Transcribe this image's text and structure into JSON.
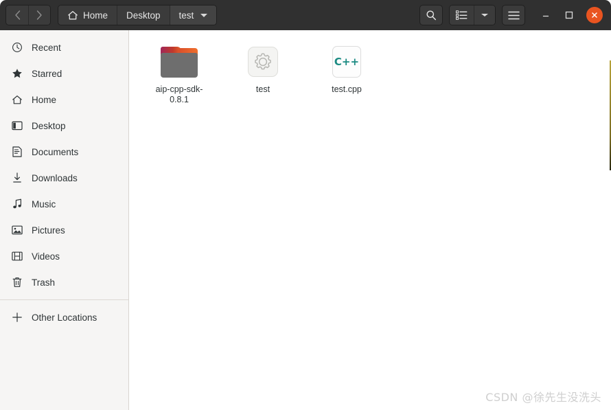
{
  "window": {
    "title": "test",
    "accent_color": "#e95420",
    "header_bg": "#303030",
    "sidebar_bg": "#f6f5f4",
    "content_bg": "#ffffff"
  },
  "header": {
    "nav": {
      "back_label": "‹",
      "back_name": "back-button",
      "forward_label": "›",
      "forward_name": "forward-button"
    },
    "breadcrumbs": [
      {
        "label": "Home",
        "icon": "home-icon",
        "current": false
      },
      {
        "label": "Desktop",
        "icon": "",
        "current": false
      },
      {
        "label": "test",
        "icon": "",
        "current": true
      }
    ],
    "tools": {
      "search_label": "",
      "view_toggle_label": "",
      "view_dropdown_label": "",
      "menu_label": ""
    },
    "window_controls": {
      "minimize": "–",
      "maximize": "☐",
      "close": "×"
    }
  },
  "sidebar": {
    "items": [
      {
        "label": "Recent",
        "icon": "clock-icon"
      },
      {
        "label": "Starred",
        "icon": "star-icon"
      },
      {
        "label": "Home",
        "icon": "home-icon"
      },
      {
        "label": "Desktop",
        "icon": "desktop-icon"
      },
      {
        "label": "Documents",
        "icon": "document-icon"
      },
      {
        "label": "Downloads",
        "icon": "download-icon"
      },
      {
        "label": "Music",
        "icon": "music-note-icon"
      },
      {
        "label": "Pictures",
        "icon": "picture-icon"
      },
      {
        "label": "Videos",
        "icon": "film-icon"
      },
      {
        "label": "Trash",
        "icon": "trash-icon"
      }
    ],
    "other_locations": {
      "label": "Other Locations",
      "icon": "plus-icon"
    }
  },
  "content": {
    "files": [
      {
        "name": "aip-cpp-sdk-0.8.1",
        "type": "folder",
        "icon": "folder-icon"
      },
      {
        "name": "test",
        "type": "executable",
        "icon": "gear-icon"
      },
      {
        "name": "test.cpp",
        "type": "source",
        "icon": "cpp-file-icon",
        "badge": "C++"
      }
    ]
  },
  "watermark": {
    "text": "CSDN @徐先生没洗头"
  }
}
